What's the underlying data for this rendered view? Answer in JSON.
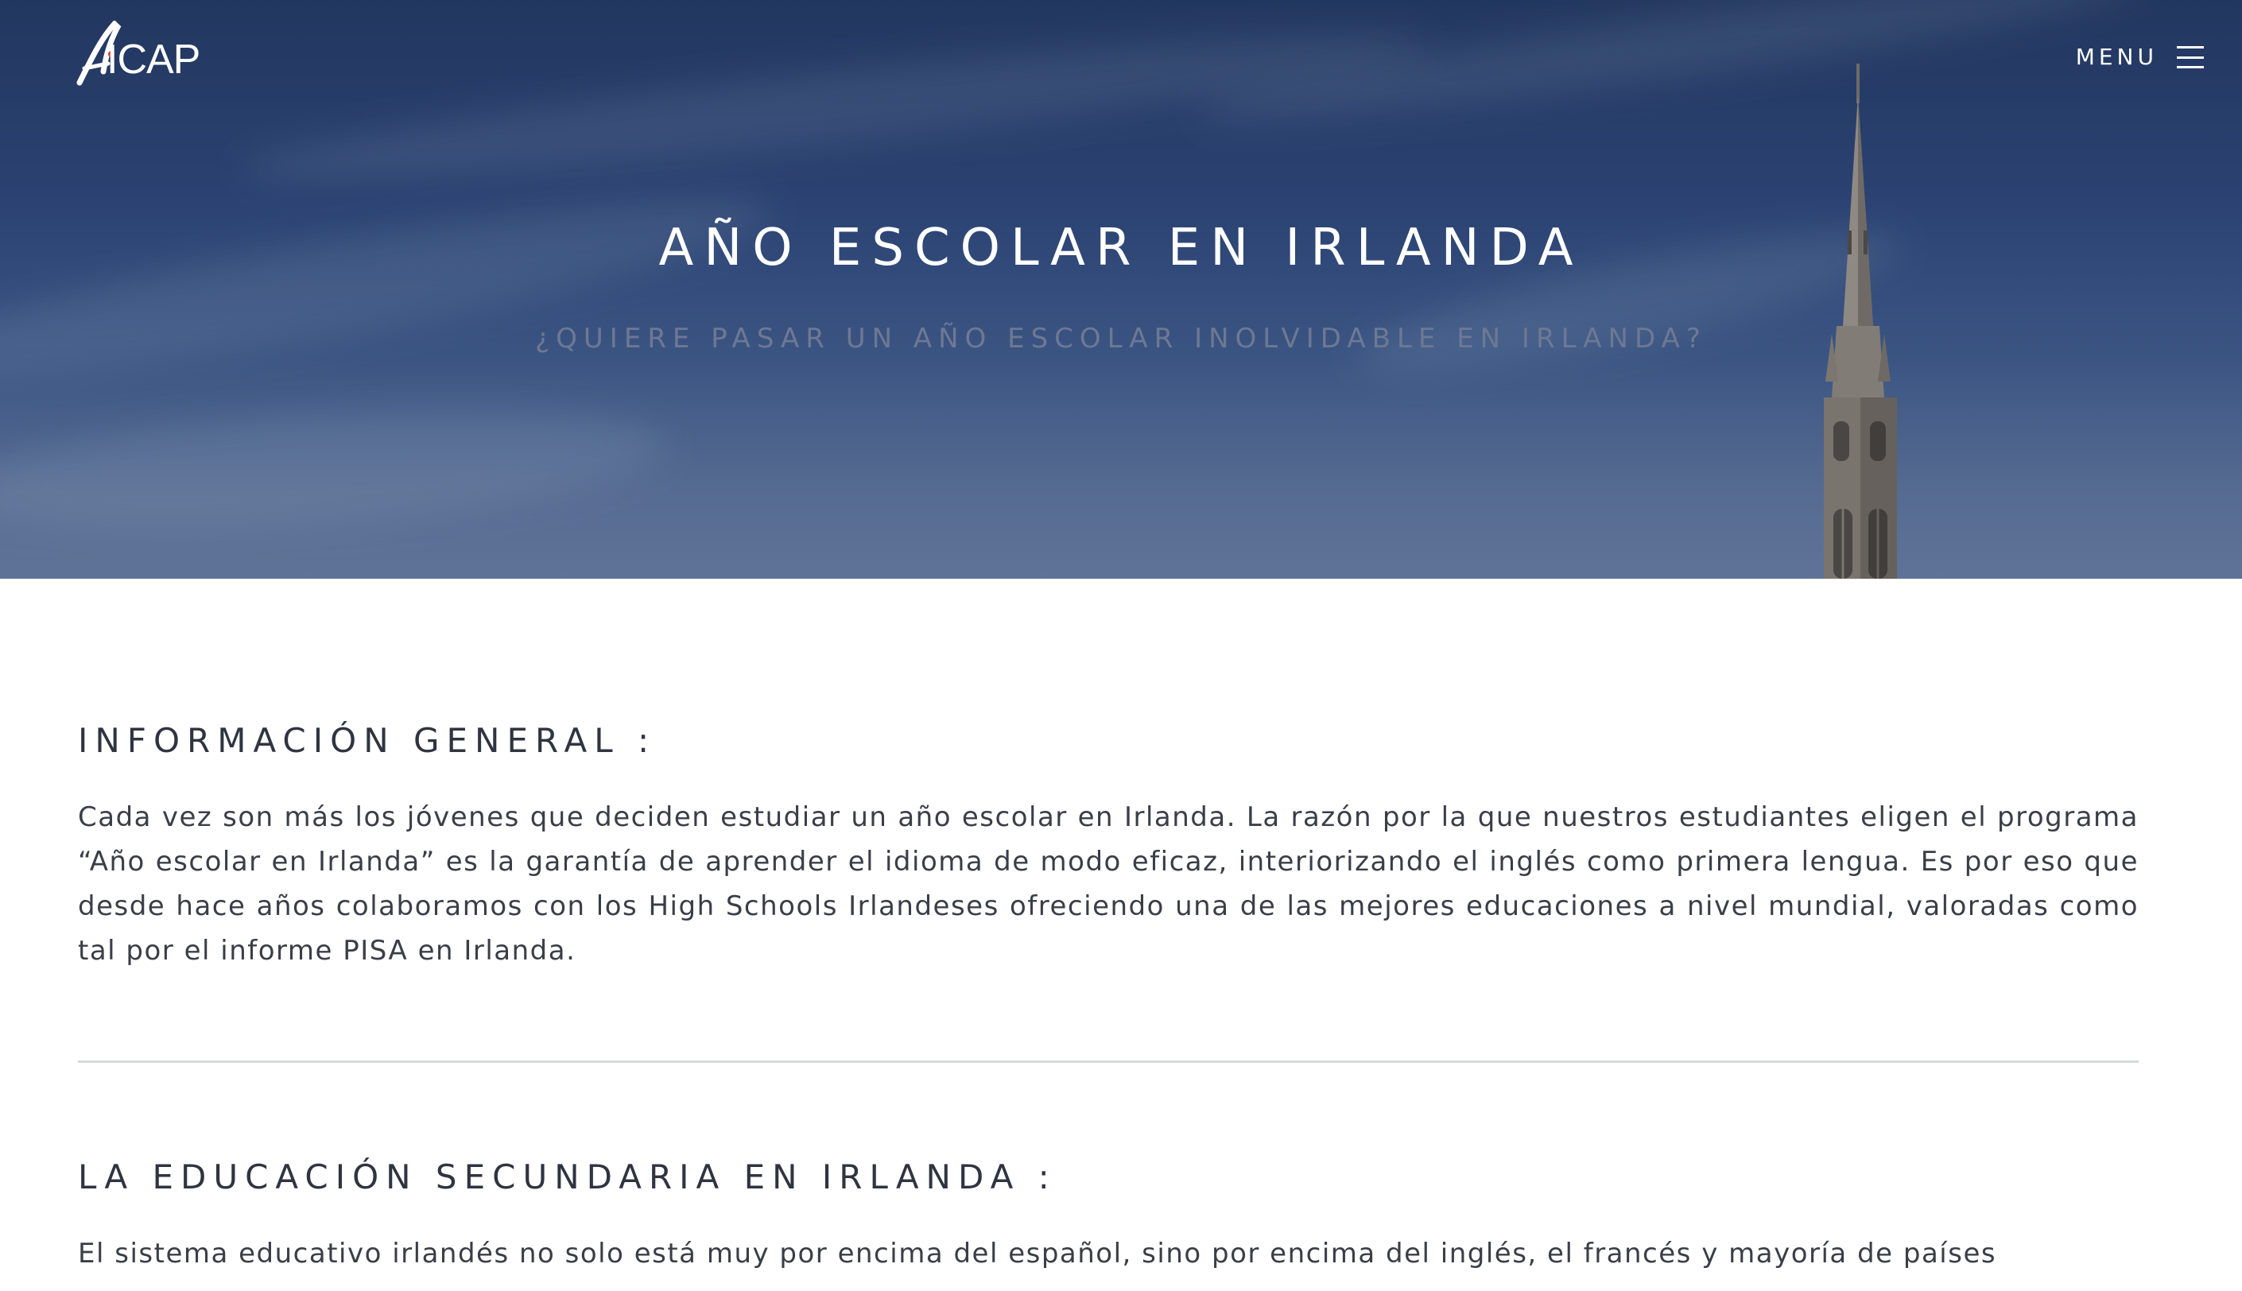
{
  "header": {
    "logo_text": "ICAP",
    "menu_label": "MENU"
  },
  "hero": {
    "title": "AÑO ESCOLAR EN IRLANDA",
    "subtitle": "¿QUIERE PASAR UN AÑO ESCOLAR INOLVIDABLE EN IRLANDA?"
  },
  "sections": [
    {
      "heading": "INFORMACIÓN GENERAL :",
      "text": "Cada vez son más los jóvenes que deciden estudiar un año escolar en Irlanda. La razón por la que nuestros estudiantes eligen el programa “Año escolar en Irlanda” es la garantía de aprender el idioma de modo eficaz, interiorizando el inglés como primera lengua. Es por eso que desde hace años colaboramos con los High Schools Irlandeses ofreciendo una de las mejores educaciones a nivel mundial, valoradas como tal por el informe PISA en Irlanda."
    },
    {
      "heading": "LA EDUCACIÓN SECUNDARIA EN IRLANDA :",
      "text": "El sistema educativo irlandés no solo está muy por encima del español, sino por encima del inglés, el francés y mayoría de países"
    }
  ],
  "colors": {
    "hero_top": "#22375f",
    "hero_bottom": "#5f7398",
    "logo_accent": "#e2332e",
    "heading": "#2f3440",
    "body_text": "#3a3e47",
    "subtitle": "#6e7893",
    "divider": "#d7d9dd"
  },
  "icons": {
    "logo": "aicap-logo-icon",
    "menu": "hamburger-menu-icon"
  }
}
